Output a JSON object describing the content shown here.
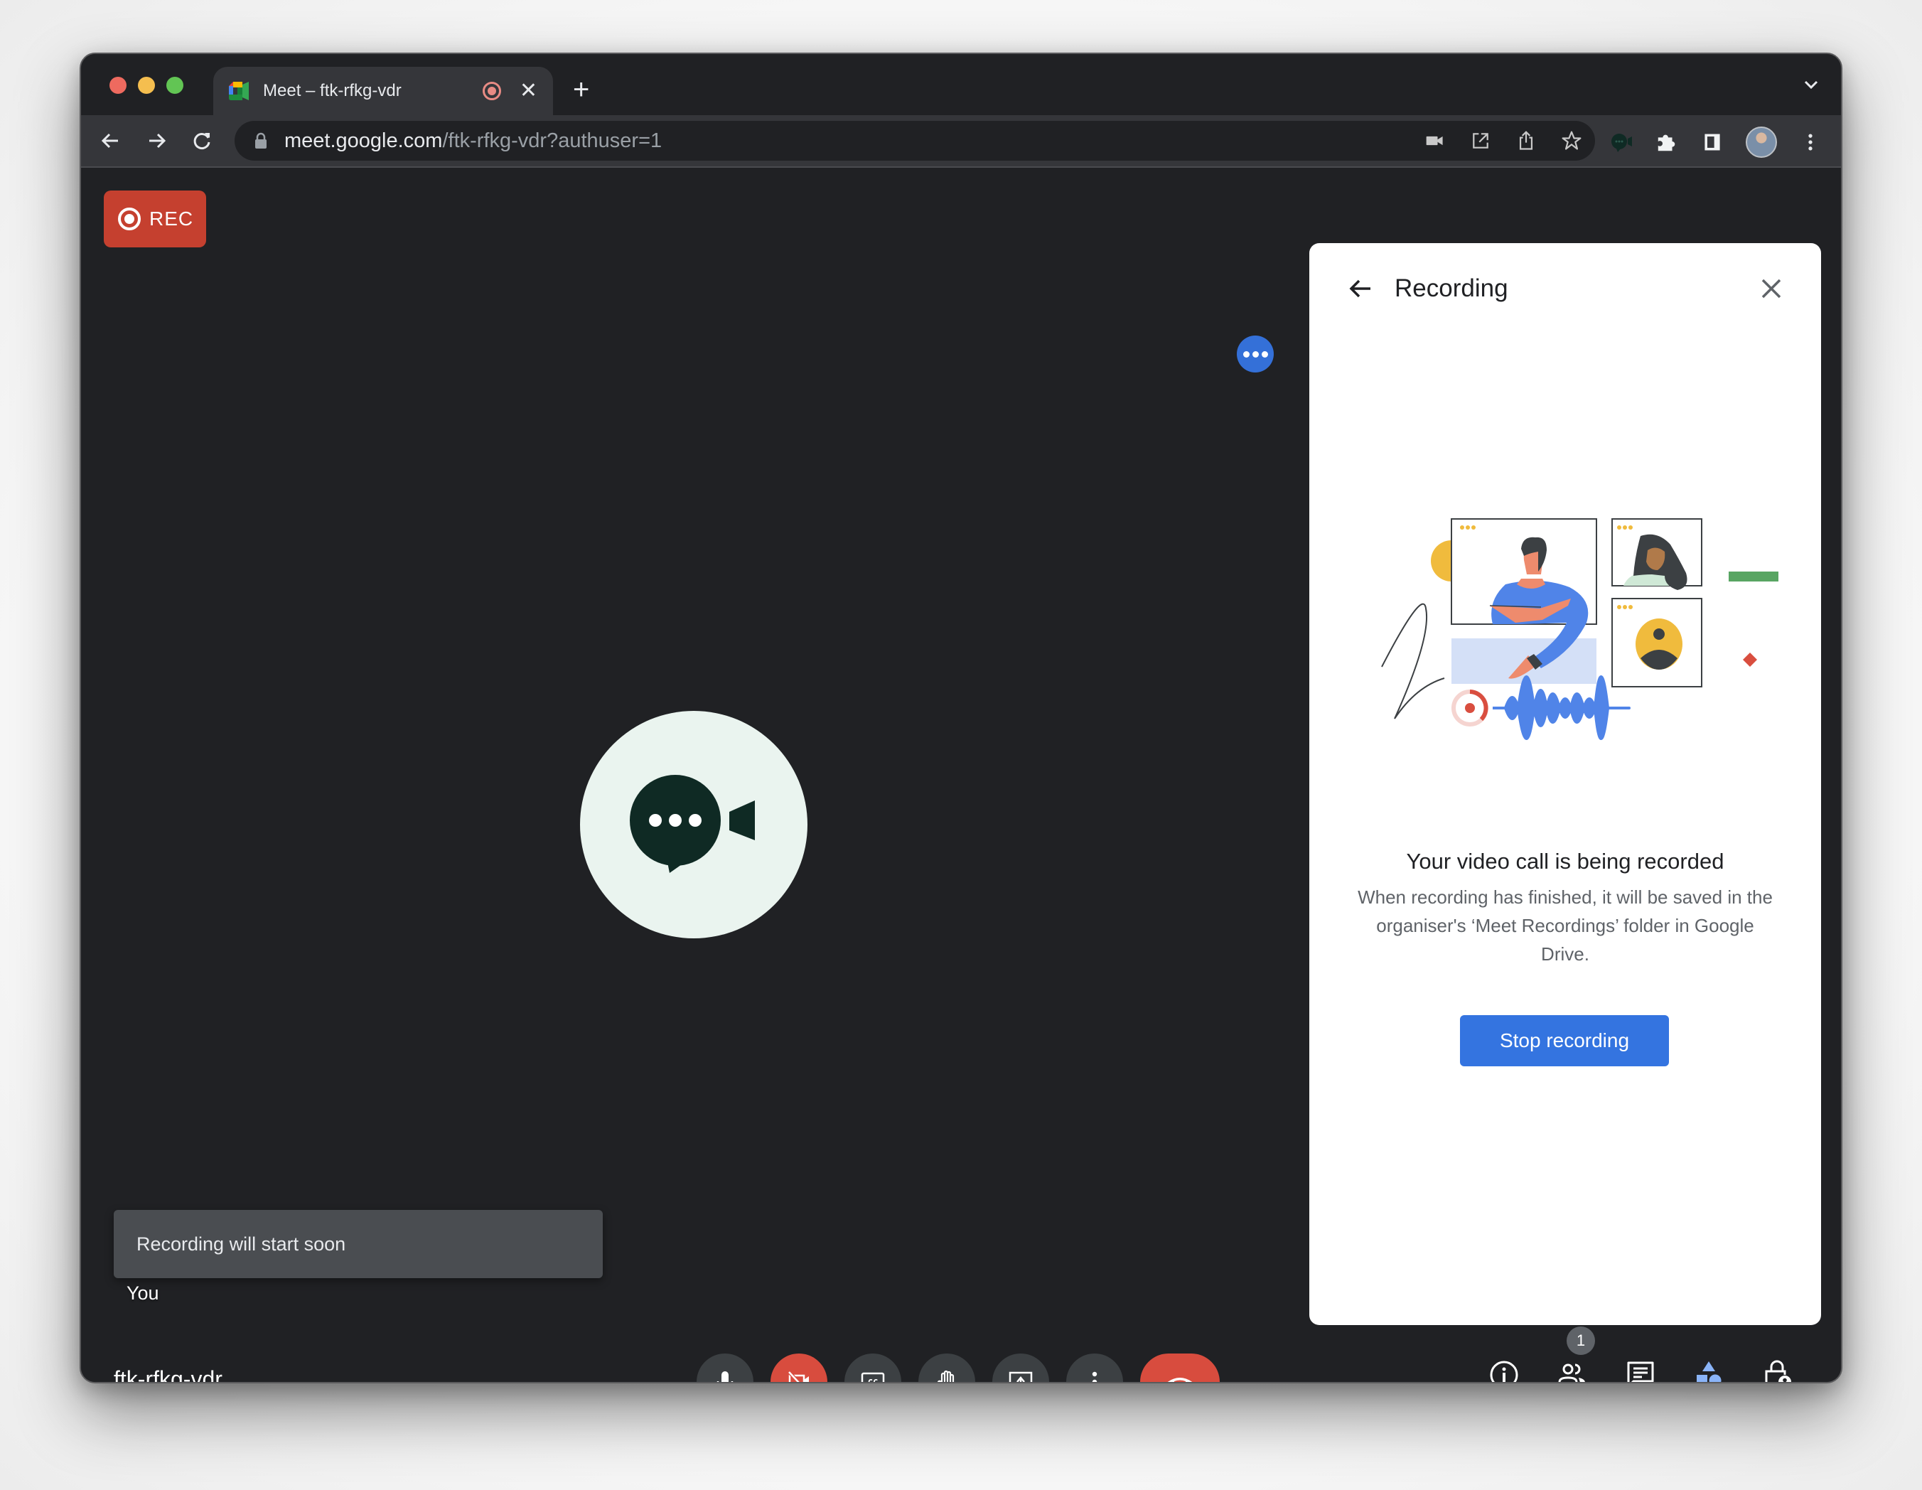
{
  "browser": {
    "tab": {
      "title": "Meet – ftk-rfkg-vdr",
      "favicon": "google-meet-icon",
      "recording_indicator": "recording-icon",
      "close_icon": "close-icon"
    },
    "new_tab_icon": "plus-icon",
    "tab_search_icon": "chevron-down-icon",
    "nav": {
      "back_icon": "arrow-left-icon",
      "forward_icon": "arrow-right-icon",
      "reload_icon": "reload-icon"
    },
    "address_bar": {
      "lock_icon": "lock-icon",
      "url_host": "meet.google.com",
      "url_path": "/ftk-rfkg-vdr?authuser=1",
      "icons": [
        "camera-in-use-icon",
        "open-in-new-icon",
        "share-icon",
        "bookmark-star-icon"
      ]
    },
    "toolbar_icons": [
      "meet-extension-icon",
      "extensions-puzzle-icon",
      "side-panel-icon",
      "profile-avatar",
      "more-vert-icon"
    ]
  },
  "meet": {
    "rec_badge": {
      "label": "REC",
      "color": "#c5402f"
    },
    "tile_more_options_icon": "more-horiz-icon",
    "participant_avatar_icon": "chat-video-logo",
    "toast": {
      "text": "Recording will start soon"
    },
    "self_label": "You",
    "meeting_code": "ftk-rfkg-vdr",
    "controls": [
      {
        "name": "microphone",
        "icon": "mic-icon",
        "state": "on"
      },
      {
        "name": "camera",
        "icon": "videocam-off-icon",
        "state": "off"
      },
      {
        "name": "captions",
        "icon": "closed-caption-icon",
        "state": "off"
      },
      {
        "name": "raise-hand",
        "icon": "hand-icon",
        "state": "off"
      },
      {
        "name": "present",
        "icon": "present-screen-icon",
        "state": "off"
      },
      {
        "name": "more-options",
        "icon": "more-vert-icon",
        "state": ""
      },
      {
        "name": "leave-call",
        "icon": "call-end-icon",
        "state": ""
      }
    ],
    "side_controls": [
      {
        "name": "meeting-details",
        "icon": "info-icon"
      },
      {
        "name": "people",
        "icon": "people-icon",
        "badge": "1"
      },
      {
        "name": "chat",
        "icon": "chat-icon"
      },
      {
        "name": "activities",
        "icon": "shapes-icon"
      },
      {
        "name": "host-controls",
        "icon": "lock-person-icon"
      }
    ]
  },
  "panel": {
    "title": "Recording",
    "back_icon": "arrow-back-icon",
    "close_icon": "close-icon",
    "illustration": "video-call-recording-illustration",
    "heading": "Your video call is being recorded",
    "body": "When recording has finished, it will be saved in the organiser's ‘Meet Recordings’ folder in Google Drive.",
    "stop_button": "Stop recording",
    "accent_color": "#3474e0"
  }
}
